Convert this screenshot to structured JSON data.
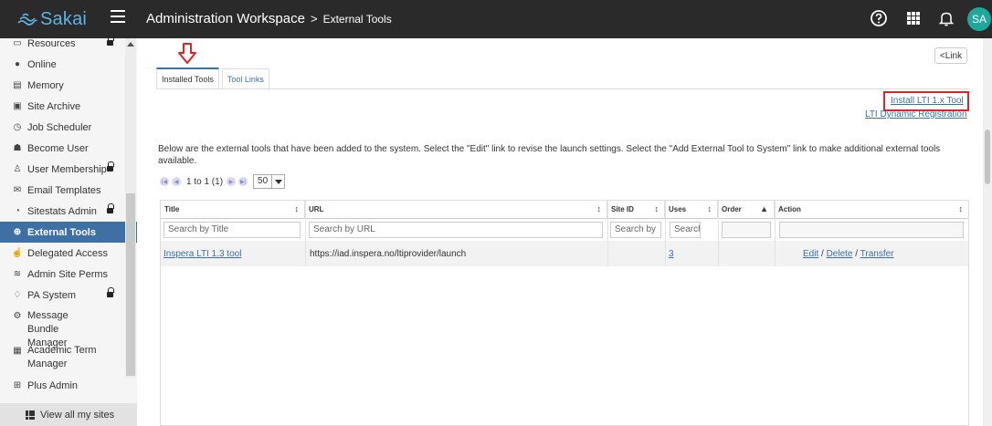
{
  "header": {
    "logo_text": "Sakai",
    "site_title": "Administration Workspace",
    "separator": ">",
    "tool_title": "External Tools",
    "avatar_initials": "SA",
    "bg_color": "#2a2a2a",
    "accent_color": "#3e70a3"
  },
  "sidebar": {
    "items": [
      {
        "label": "Resources",
        "icon": "folder-icon",
        "locked": true
      },
      {
        "label": "Online",
        "icon": "database-icon"
      },
      {
        "label": "Memory",
        "icon": "memory-icon"
      },
      {
        "label": "Site Archive",
        "icon": "archive-icon"
      },
      {
        "label": "Job Scheduler",
        "icon": "clock-icon"
      },
      {
        "label": "Become User",
        "icon": "user-secret-icon"
      },
      {
        "label": "User Membership",
        "icon": "user-icon",
        "locked": true
      },
      {
        "label": "Email Templates",
        "icon": "email-icon"
      },
      {
        "label": "Sitestats Admin",
        "icon": "stats-icon",
        "locked": true
      },
      {
        "label": "External Tools",
        "icon": "globe-icon",
        "active": true
      },
      {
        "label": "Delegated Access",
        "icon": "hand-icon"
      },
      {
        "label": "Admin Site Perms",
        "icon": "sliders-icon"
      },
      {
        "label": "PA System",
        "icon": "bell-icon",
        "locked": true
      },
      {
        "label": "Message Bundle Manager",
        "icon": "gear-icon",
        "two_line": true
      },
      {
        "label": "Academic Term Manager",
        "icon": "calendar-icon",
        "two_line": true
      },
      {
        "label": "Plus Admin",
        "icon": "plus-square-icon"
      }
    ],
    "view_all": "View all my sites"
  },
  "main": {
    "tabs": [
      "Installed Tools",
      "Tool Links"
    ],
    "link_button": "Link",
    "install_link": "Install LTI 1.x Tool",
    "dynamic_registration_link": "LTI Dynamic Registration",
    "description": "Below are the external tools that have been added to the system. Select the \"Edit\" link to revise the launch settings. Select the \"Add External Tool to System\" link to make additional external tools available.",
    "pager": {
      "range": "1 to 1 (1)",
      "page_size": "50"
    },
    "table": {
      "columns": [
        "Title",
        "URL",
        "Site ID",
        "Uses",
        "Order",
        "Action"
      ],
      "filters": {
        "title": "Search by Title",
        "url": "Search by URL",
        "site_id": "Search by",
        "uses": "Search",
        "order": "",
        "action": ""
      },
      "rows": [
        {
          "title": "Inspera LTI 1.3 tool",
          "url": "https://iad.inspera.no/ltiprovider/launch",
          "site_id": "",
          "uses": "3",
          "order": "",
          "actions": [
            "Edit",
            "Delete",
            "Transfer"
          ],
          "action_sep": "/"
        }
      ]
    },
    "highlight_color": "#e02424"
  }
}
